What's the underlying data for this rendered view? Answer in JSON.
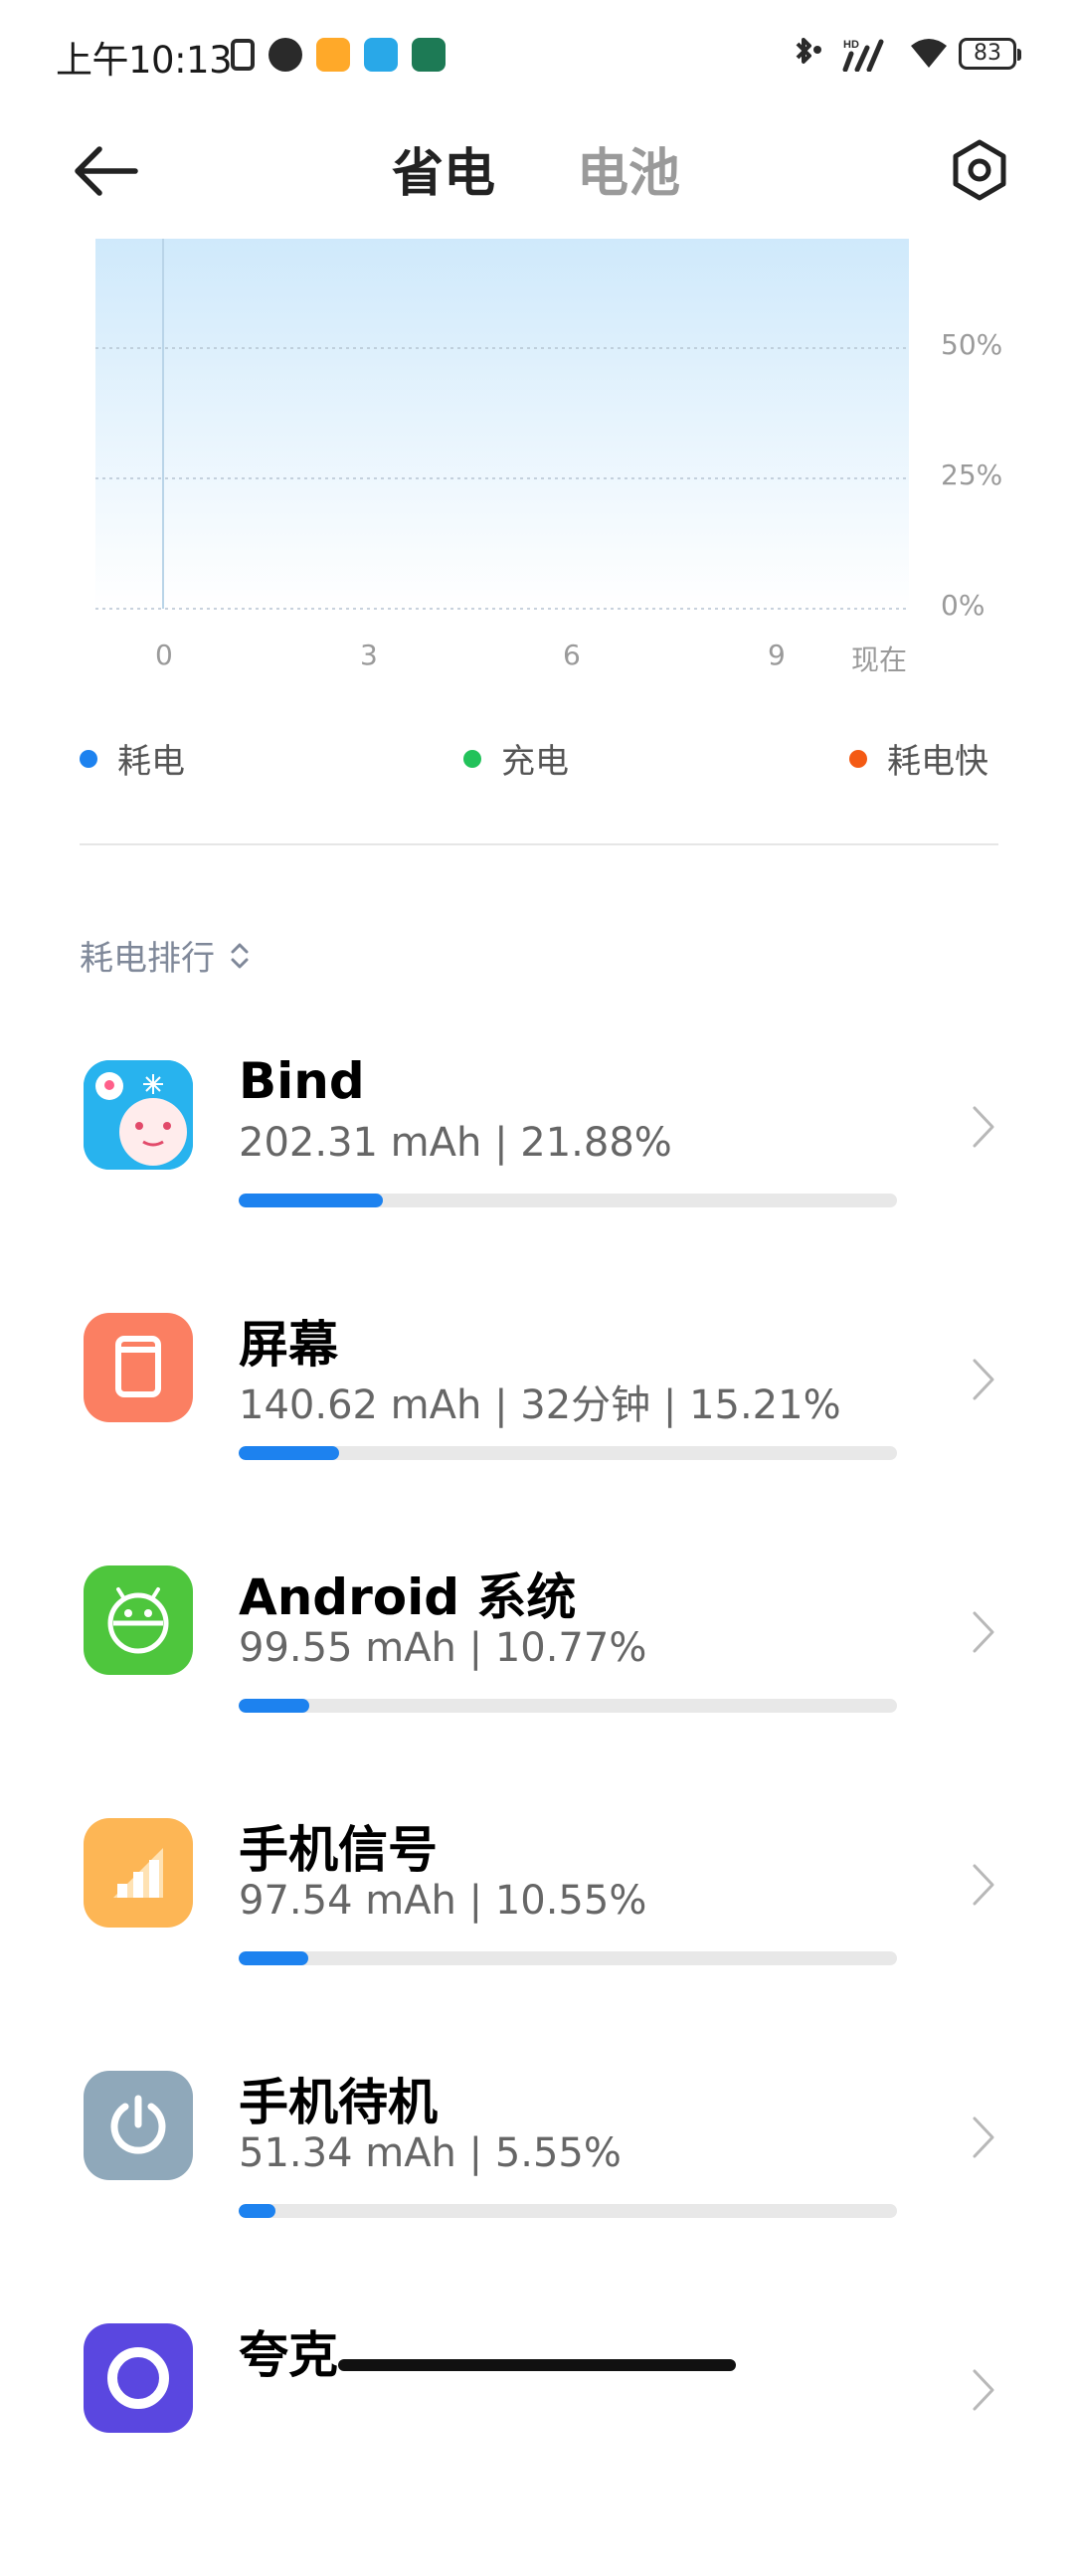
{
  "status_bar": {
    "time": "上午10:13",
    "battery": "83",
    "signal_label": "HD"
  },
  "header": {
    "tab_active": "省电",
    "tab_inactive": "电池"
  },
  "chart_data": {
    "type": "area",
    "x_ticks": [
      "0",
      "3",
      "6",
      "9",
      "现在"
    ],
    "y_ticks": [
      "50%",
      "25%",
      "0%"
    ],
    "ylim": [
      0,
      70
    ],
    "grid": true,
    "series": []
  },
  "legend": [
    {
      "label": "耗电",
      "color": "#1d82ef"
    },
    {
      "label": "充电",
      "color": "#22c25a"
    },
    {
      "label": "耗电快",
      "color": "#f45a14"
    }
  ],
  "ranking": {
    "title": "耗电排行",
    "items": [
      {
        "name": "Bind",
        "detail": "202.31 mAh | 21.88%",
        "percent": 21.88,
        "icon": "bind-app-icon"
      },
      {
        "name": "屏幕",
        "detail": "140.62 mAh | 32分钟 | 15.21%",
        "percent": 15.21,
        "icon": "screen-icon"
      },
      {
        "name": "Android 系统",
        "detail": "99.55 mAh | 10.77%",
        "percent": 10.77,
        "icon": "android-icon"
      },
      {
        "name": "手机信号",
        "detail": "97.54 mAh | 10.55%",
        "percent": 10.55,
        "icon": "signal-icon"
      },
      {
        "name": "手机待机",
        "detail": "51.34 mAh | 5.55%",
        "percent": 5.55,
        "icon": "power-icon"
      },
      {
        "name": "夸克",
        "detail": "",
        "percent": 0,
        "icon": "quark-icon"
      }
    ]
  }
}
